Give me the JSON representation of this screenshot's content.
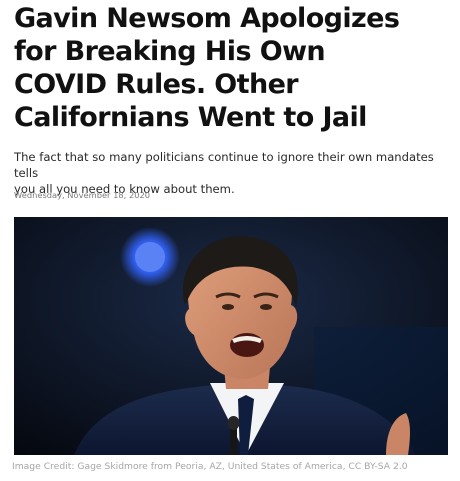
{
  "article": {
    "headline_lines": [
      "Gavin Newsom Apologizes",
      "for Breaking His Own",
      "COVID Rules. Other",
      "Californians Went to Jail"
    ],
    "dek_lines": [
      "The fact that so many politicians continue to ignore their own mandates tells",
      "you all you need to know about them."
    ],
    "date": "Wednesday, November 18, 2020",
    "photo_caption": "Image Credit: Gage Skidmore from Peoria, AZ, United States of America, CC BY-SA 2.0"
  },
  "colors": {
    "headline": "#111111",
    "dek": "#2a2a2a",
    "date": "#7a7a7a",
    "caption": "#a6a6a6",
    "photo_background": "#0b1220",
    "stage_light": "#3c6df0"
  }
}
